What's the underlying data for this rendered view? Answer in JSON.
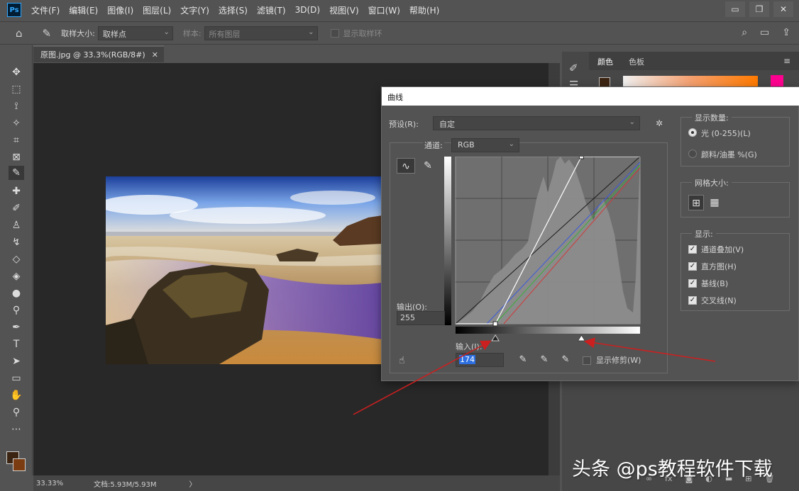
{
  "app": {
    "logo": "Ps",
    "menu": [
      "文件(F)",
      "编辑(E)",
      "图像(I)",
      "图层(L)",
      "文字(Y)",
      "选择(S)",
      "滤镜(T)",
      "3D(D)",
      "视图(V)",
      "窗口(W)",
      "帮助(H)"
    ],
    "window_controls": [
      "▭",
      "❐",
      "✕"
    ]
  },
  "options": {
    "sample_size_label": "取样大小:",
    "sample_size_value": "取样点",
    "sample_label": "样本:",
    "sample_value": "所有图层",
    "show_ring_label": "显示取样环"
  },
  "document": {
    "tab_title": "原图.jpg @ 33.3%(RGB/8#)",
    "tab_close": "✕",
    "zoom": "33.33%",
    "doc_info": "文档:5.93M/5.93M",
    "status_arrow": "〉"
  },
  "panels": {
    "tab_color": "颜色",
    "tab_swatches": "色板"
  },
  "curves": {
    "title": "曲线",
    "preset_label": "预设(R):",
    "preset_value": "自定",
    "channel_label": "通道:",
    "channel_value": "RGB",
    "output_label": "输出(O):",
    "output_value": "255",
    "input_label": "输入(I):",
    "input_value": "174",
    "show_clipping_label": "显示修剪(W)",
    "display_amount_title": "显示数量:",
    "light_option": "光 (0-255)(L)",
    "pigment_option": "颜料/油墨 %(G)",
    "grid_size_title": "网格大小:",
    "display_title": "显示:",
    "display_options": [
      "通道叠加(V)",
      "直方图(H)",
      "基线(B)",
      "交叉线(N)"
    ],
    "points": [
      [
        0,
        0
      ],
      [
        55,
        0
      ],
      [
        174,
        255
      ],
      [
        255,
        255
      ]
    ]
  },
  "watermark": "头条 @ps教程软件下载",
  "colors": {
    "accent": "#ff0090",
    "foreground": "#3c2412",
    "background": "#7a3c10",
    "annotation_arrow": "#cc1f1f"
  }
}
